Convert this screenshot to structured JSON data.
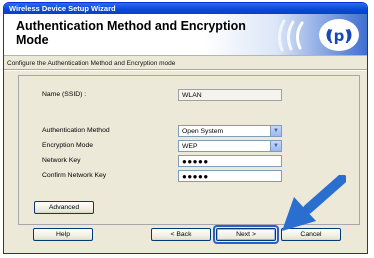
{
  "window": {
    "title": "Wireless Device Setup Wizard"
  },
  "header": {
    "title": "Authentication Method and Encryption Mode"
  },
  "subtitle": "Configure the Authentication Method and Encryption mode",
  "ssid": {
    "label": "Name (SSID) :",
    "value": "WLAN"
  },
  "auth_method": {
    "label": "Authentication Method",
    "value": "Open System"
  },
  "encryption_mode": {
    "label": "Encryption Mode",
    "value": "WEP"
  },
  "network_key": {
    "label": "Network Key",
    "value": "●●●●●"
  },
  "confirm_key": {
    "label": "Confirm Network Key",
    "value": "●●●●●"
  },
  "buttons": {
    "advanced": "Advanced",
    "help": "Help",
    "back": "< Back",
    "next": "Next >",
    "cancel": "Cancel"
  },
  "colors": {
    "titlebar": "#0a4ad6",
    "accent_arrow": "#2a6fd0",
    "focus_outline": "#2a5fc7"
  }
}
